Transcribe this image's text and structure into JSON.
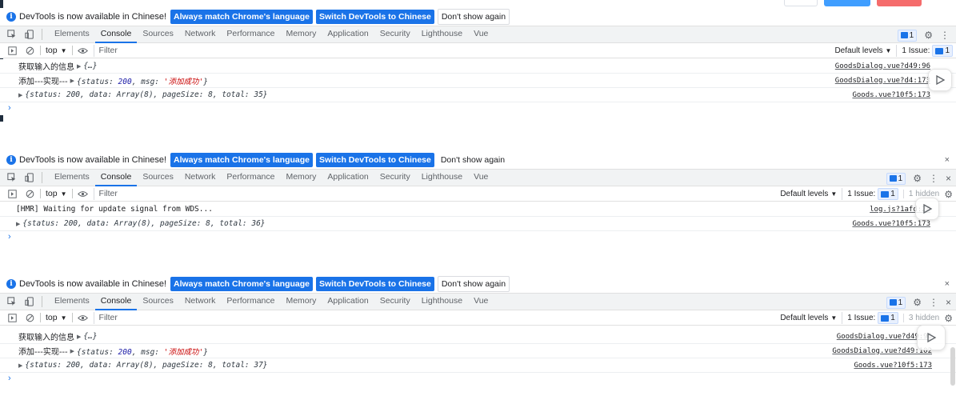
{
  "infobar": {
    "message": "DevTools is now available in Chinese!",
    "match_label": "Always match Chrome's language",
    "switch_label": "Switch DevTools to Chinese",
    "dismiss_label": "Don't show again",
    "close_glyph": "×"
  },
  "tabs": [
    "Elements",
    "Console",
    "Sources",
    "Network",
    "Performance",
    "Memory",
    "Application",
    "Security",
    "Lighthouse",
    "Vue"
  ],
  "active_tab": "Console",
  "toolbar": {
    "context": "top",
    "filter_placeholder": "Filter",
    "levels_label": "Default levels",
    "issues_label": "1 Issue:",
    "issues_count": "1",
    "messages_count": "1",
    "hidden_label_1": "1 hidden",
    "hidden_label_2": "3 hidden"
  },
  "panels": [
    {
      "rows": [
        {
          "text": "获取输入的信息",
          "value": "{…}",
          "source": "GoodsDialog.vue?d49:96"
        },
        {
          "text": "添加---实现---",
          "obj_prefix": "{status: ",
          "status": "200",
          "obj_mid": ", msg: ",
          "msg": "'添加成功'",
          "obj_suffix": "}",
          "source": "GoodsDialog.vue?d4:173"
        },
        {
          "obj": "{status: 200, data: Array(8), pageSize: 8, total: 35}",
          "source": "Goods.vue?10f5:173"
        }
      ]
    },
    {
      "rows": [
        {
          "log": "[HMR] Waiting for update signal from WDS...",
          "source": "log.js?1afd:24"
        },
        {
          "obj": "{status: 200, data: Array(8), pageSize: 8, total: 36}",
          "source": "Goods.vue?10f5:173"
        }
      ]
    },
    {
      "rows": [
        {
          "text": "获取输入的信息",
          "value": "{…}",
          "source": "GoodsDialog.vue?d49:96"
        },
        {
          "text": "添加---实现---",
          "obj_prefix": "{status: ",
          "status": "200",
          "obj_mid": ", msg: ",
          "msg": "'添加成功'",
          "obj_suffix": "}",
          "source": "GoodsDialog.vue?d49:102"
        },
        {
          "obj": "{status: 200, data: Array(8), pageSize: 8, total: 37}",
          "source": "Goods.vue?10f5:173"
        }
      ]
    }
  ],
  "prompt_glyph": "›",
  "colors": {
    "accent": "#1a73e8",
    "string": "#c80000",
    "number": "#1a1aa6",
    "sidebar": "#1f2d3d"
  },
  "icons": [
    "info-icon",
    "inspect-icon",
    "device-toggle-icon",
    "sidebar-toggle-icon",
    "clear-console-icon",
    "eye-icon",
    "gear-icon",
    "kebab-menu-icon",
    "close-icon",
    "issues-flag-icon",
    "caret-down-icon",
    "expand-triangle-icon"
  ]
}
